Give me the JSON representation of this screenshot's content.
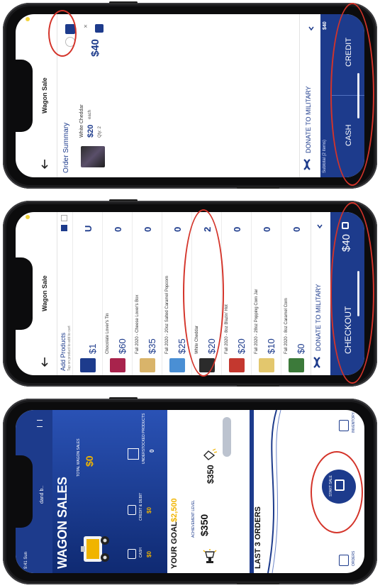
{
  "phone3": {
    "status_left": "9:41 Sun",
    "account": "dand b..",
    "title": "WAGON SALES",
    "stats": [
      {
        "label": "CASH",
        "value": "$0"
      },
      {
        "label": "CREDIT & DEBIT",
        "value": "$0"
      }
    ],
    "total_label": "TOTAL WAGON SALES",
    "total_value": "$0",
    "under_label": "UNDERSTOCKED PRODUCTS",
    "under_value": "0",
    "goal_label": "YOUR GOAL",
    "goal_value": "$2,500",
    "trophy_label": "ACHIEVEMENT LEVEL",
    "trophy_value": "$350",
    "progress_value": "$350",
    "last_orders": "LAST 3 ORDERS",
    "start_sale": "START SALE",
    "orders_label": "ORDERS",
    "inventory_label": "INVENTORY"
  },
  "phone2": {
    "header_title": "Wagon Sale",
    "add_products": "Add Products",
    "add_products_sub": "Tap on product to add to cart",
    "items": [
      {
        "name": "",
        "price": "$1",
        "qty": "U"
      },
      {
        "name": "Chocolate Lover's Tin",
        "price": "$60",
        "qty": "0"
      },
      {
        "name": "Fall 2020 - Cheese Lover's Box",
        "price": "$35",
        "qty": "0"
      },
      {
        "name": "Fall 2020 - 20oz Salted Caramel Popcorn",
        "price": "$25",
        "qty": "0"
      },
      {
        "name": "White Cheddar",
        "price": "$20",
        "qty": "2"
      },
      {
        "name": "Fall 2020 - 8oz Blazin' Hot",
        "price": "$20",
        "qty": "0"
      },
      {
        "name": "Fall 2020 - 28oz Popping Corn Jar",
        "price": "$10",
        "qty": "0"
      },
      {
        "name": "Fall 2020 - 8oz Caramel Corn",
        "price": "$0",
        "qty": "0"
      }
    ],
    "donate": "DONATE TO MILITARY",
    "checkout": "CHECKOUT",
    "checkout_total": "$40"
  },
  "phone1": {
    "header_title": "Wagon Sale",
    "order_summary": "Order Summary",
    "item_name": "White Cheddar",
    "item_price": "$20",
    "item_each": "each",
    "item_qty": "Qty: 2",
    "item_total": "$40",
    "donate": "DONATE TO MILITARY",
    "subtotal_label": "Subtotal (2 items)",
    "subtotal_value": "$40",
    "cash": "CASH",
    "credit": "CREDIT"
  },
  "colors": {
    "brand_blue": "#1d3b8c",
    "annotation_red": "#d4342a",
    "gold": "#f0b400"
  }
}
